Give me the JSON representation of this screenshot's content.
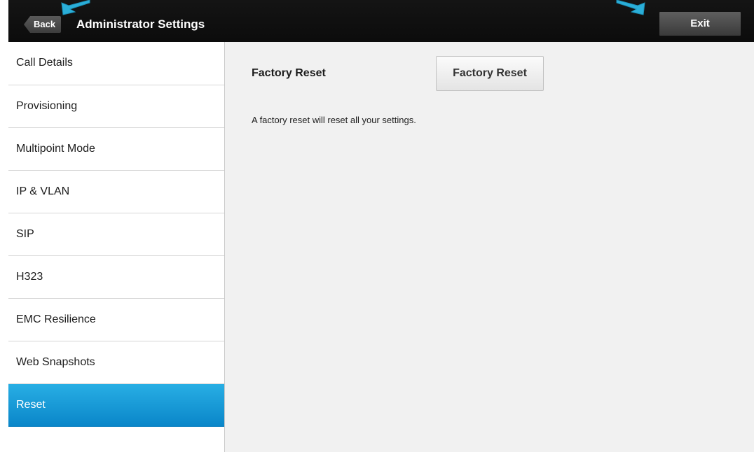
{
  "header": {
    "back_label": "Back",
    "title": "Administrator Settings",
    "exit_label": "Exit"
  },
  "sidebar": {
    "items": [
      {
        "label": "Call Details",
        "selected": false
      },
      {
        "label": "Provisioning",
        "selected": false
      },
      {
        "label": "Multipoint Mode",
        "selected": false
      },
      {
        "label": "IP & VLAN",
        "selected": false
      },
      {
        "label": "SIP",
        "selected": false
      },
      {
        "label": "H323",
        "selected": false
      },
      {
        "label": "EMC Resilience",
        "selected": false
      },
      {
        "label": "Web Snapshots",
        "selected": false
      },
      {
        "label": "Reset",
        "selected": true
      }
    ]
  },
  "main": {
    "setting_label": "Factory Reset",
    "button_label": "Factory Reset",
    "description": "A factory reset will reset all your settings."
  },
  "colors": {
    "accent": "#1a9bd7",
    "annotation_arrow": "#2aaed8",
    "topbar": "#111111"
  },
  "icons": {
    "back_arrow": "back-pointer-arrow-icon",
    "exit_arrow": "exit-pointer-arrow-icon"
  }
}
